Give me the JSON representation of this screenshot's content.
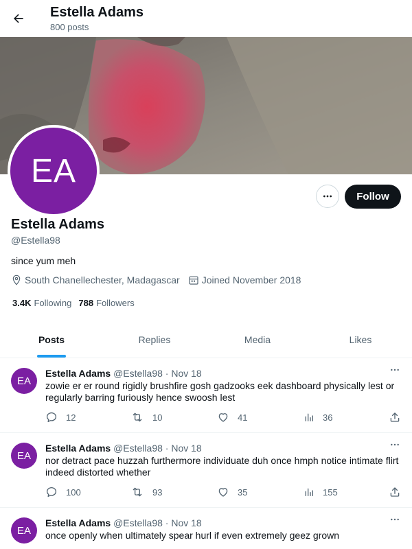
{
  "header": {
    "title": "Estella Adams",
    "post_count": "800 posts"
  },
  "profile": {
    "initials": "EA",
    "name": "Estella Adams",
    "handle": "@Estella98",
    "bio": "since yum meh",
    "location": "South Chanellechester, Madagascar",
    "joined": "Joined November 2018",
    "following_count": "3.4K",
    "following_label": "Following",
    "followers_count": "788",
    "followers_label": "Followers",
    "follow_label": "Follow"
  },
  "tabs": [
    {
      "label": "Posts",
      "active": true
    },
    {
      "label": "Replies",
      "active": false
    },
    {
      "label": "Media",
      "active": false
    },
    {
      "label": "Likes",
      "active": false
    }
  ],
  "posts": [
    {
      "initials": "EA",
      "name": "Estella Adams",
      "handle": "@Estella98",
      "date": "· Nov 18",
      "text": "zowie er er round rigidly brushfire gosh gadzooks eek dashboard physically lest or regularly barring furiously hence swoosh lest",
      "replies": "12",
      "reposts": "10",
      "likes": "41",
      "views": "36"
    },
    {
      "initials": "EA",
      "name": "Estella Adams",
      "handle": "@Estella98",
      "date": "· Nov 18",
      "text": "nor detract pace huzzah furthermore individuate duh once hmph notice intimate flirt indeed distorted whether",
      "replies": "100",
      "reposts": "93",
      "likes": "35",
      "views": "155"
    },
    {
      "initials": "EA",
      "name": "Estella Adams",
      "handle": "@Estella98",
      "date": "· Nov 18",
      "text": "once openly when ultimately spear hurl if even extremely geez grown",
      "replies": "",
      "reposts": "",
      "likes": "",
      "views": ""
    }
  ],
  "colors": {
    "accent": "#1d9bf0",
    "avatar": "#7b1fa2",
    "text": "#0f1419",
    "muted": "#536471"
  }
}
